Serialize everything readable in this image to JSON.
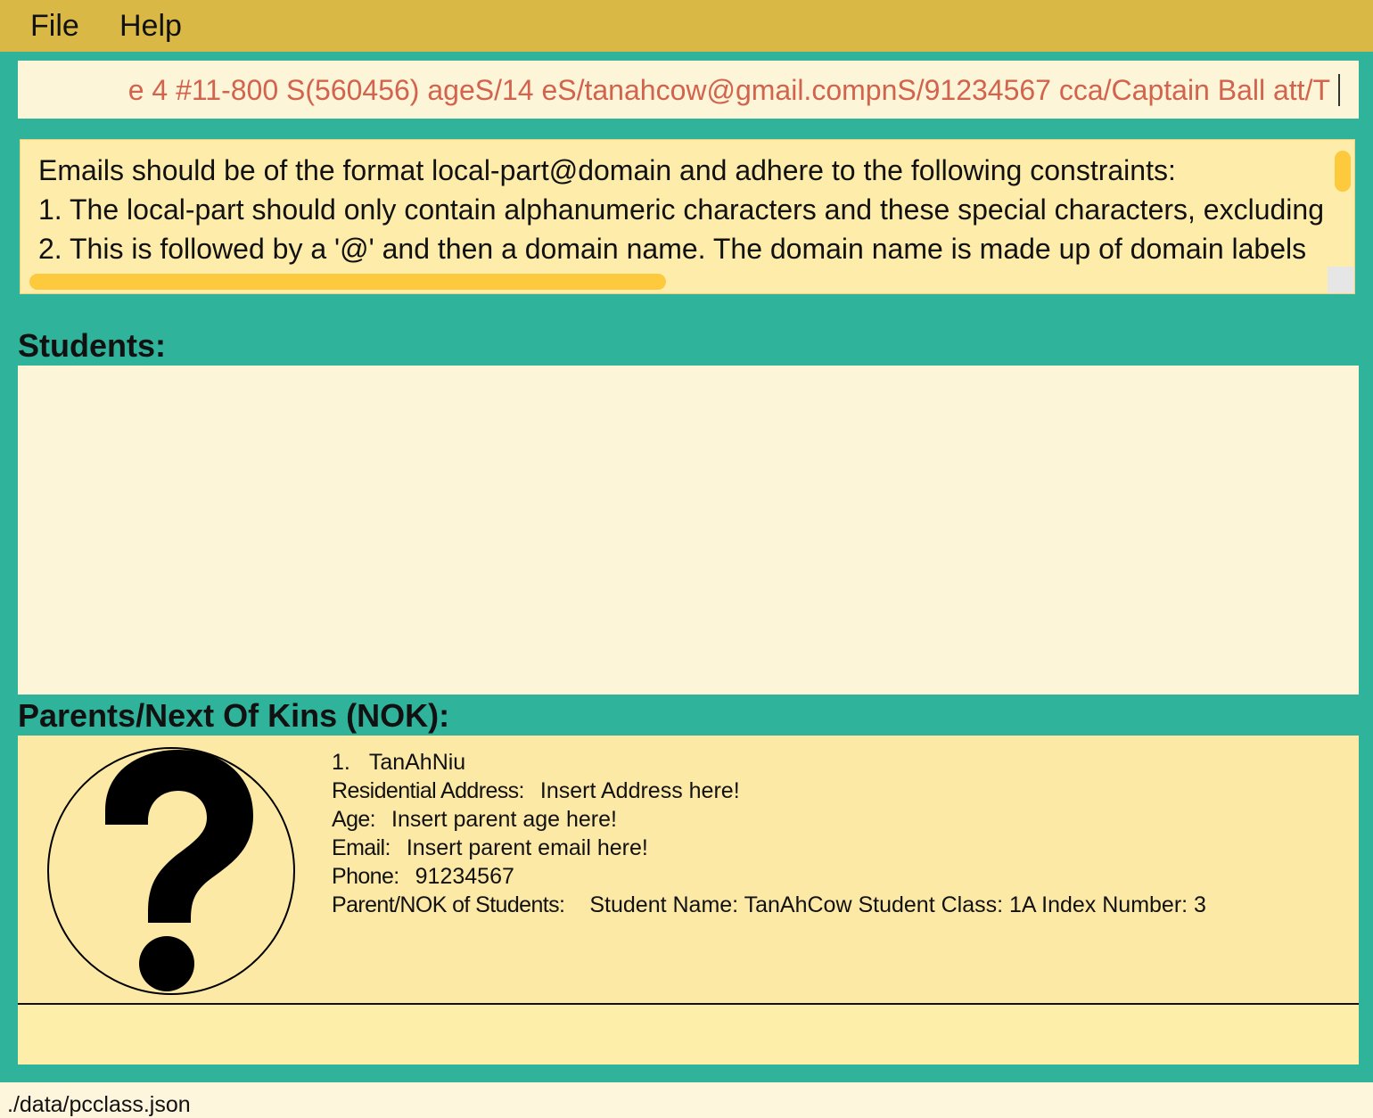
{
  "menu": {
    "file": "File",
    "help": "Help"
  },
  "command": {
    "value": "e 4 #11-800 S(560456) ageS/14 eS/tanahcow@gmail.compnS/91234567 cca/Captain Ball att/T"
  },
  "result": {
    "lines": [
      "Emails should be of the format local-part@domain and adhere to the following constraints:",
      "1. The local-part should only contain alphanumeric characters and these special characters, excluding",
      "2. This is followed by a '@' and then a domain name. The domain name is made up of domain labels"
    ]
  },
  "students": {
    "title": "Students:"
  },
  "nok": {
    "title": "Parents/Next Of Kins (NOK):",
    "cards": [
      {
        "index": "1.",
        "name": "TanAhNiu",
        "address_label": "Residential Address:",
        "address": "Insert Address here!",
        "age_label": "Age:",
        "age": "Insert parent age here!",
        "email_label": "Email:",
        "email": "Insert parent email here!",
        "phone_label": "Phone:",
        "phone": "91234567",
        "students_label": "Parent/NOK of Students:",
        "students": "Student Name: TanAhCow Student Class: 1A Index Number: 3",
        "avatar_icon": "question-mark-icon"
      }
    ]
  },
  "status": {
    "path": "./data/pcclass.json"
  },
  "colors": {
    "background": "#2fb39b",
    "menubar": "#d9b846",
    "panel": "#fdf5d7",
    "card": "#fce9a6",
    "command_text": "#d2634e",
    "scroll_thumb": "#fcca3c"
  }
}
